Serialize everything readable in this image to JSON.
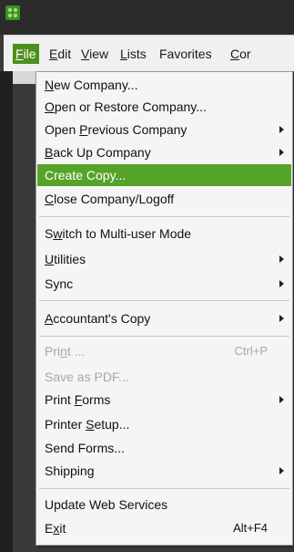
{
  "menubar": {
    "items": [
      {
        "label": "File",
        "mnemonic": "F",
        "active": true
      },
      {
        "label": "Edit",
        "mnemonic": "E",
        "active": false
      },
      {
        "label": "View",
        "mnemonic": "V",
        "active": false
      },
      {
        "label": "Lists",
        "mnemonic": "L",
        "active": false
      },
      {
        "label": "Favorites",
        "mnemonic": "",
        "active": false
      },
      {
        "label": "Cor",
        "mnemonic": "C",
        "active": false
      }
    ]
  },
  "file_menu": {
    "items": [
      {
        "label": "New Company...",
        "mnemonic_index": 0,
        "submenu": false,
        "enabled": true
      },
      {
        "label": "Open or Restore Company...",
        "mnemonic_index": 0,
        "submenu": false,
        "enabled": true
      },
      {
        "label": "Open Previous Company",
        "mnemonic_index": 5,
        "submenu": true,
        "enabled": true
      },
      {
        "label": "Back Up Company",
        "mnemonic_index": 0,
        "submenu": true,
        "enabled": true
      },
      {
        "label": "Create Copy...",
        "mnemonic_index": -1,
        "submenu": false,
        "enabled": true,
        "highlighted": true
      },
      {
        "label": "Close Company/Logoff",
        "mnemonic_index": 0,
        "submenu": false,
        "enabled": true
      },
      {
        "label": "Switch to Multi-user Mode",
        "mnemonic_index": 1,
        "submenu": false,
        "enabled": true
      },
      {
        "label": "Utilities",
        "mnemonic_index": 0,
        "submenu": true,
        "enabled": true
      },
      {
        "label": "Sync",
        "mnemonic_index": -1,
        "submenu": true,
        "enabled": true
      },
      {
        "label": "Accountant's Copy",
        "mnemonic_index": 0,
        "submenu": true,
        "enabled": true
      },
      {
        "label": "Print ...",
        "mnemonic_index": 3,
        "submenu": false,
        "enabled": false,
        "shortcut": "Ctrl+P"
      },
      {
        "label": "Save as PDF...",
        "mnemonic_index": -1,
        "submenu": false,
        "enabled": false
      },
      {
        "label": "Print Forms",
        "mnemonic_index": 6,
        "submenu": true,
        "enabled": true
      },
      {
        "label": "Printer Setup...",
        "mnemonic_index": 8,
        "submenu": false,
        "enabled": true
      },
      {
        "label": "Send Forms...",
        "mnemonic_index": -1,
        "submenu": false,
        "enabled": true
      },
      {
        "label": "Shipping",
        "mnemonic_index": 7,
        "submenu": true,
        "enabled": true
      },
      {
        "label": "Update Web Services",
        "mnemonic_index": -1,
        "submenu": false,
        "enabled": true
      },
      {
        "label": "Exit",
        "mnemonic_index": 1,
        "submenu": false,
        "enabled": true,
        "shortcut": "Alt+F4"
      }
    ]
  },
  "colors": {
    "highlight": "#56a329",
    "menubar_active": "#4d8f1f",
    "disabled_text": "#a7a7a7"
  }
}
